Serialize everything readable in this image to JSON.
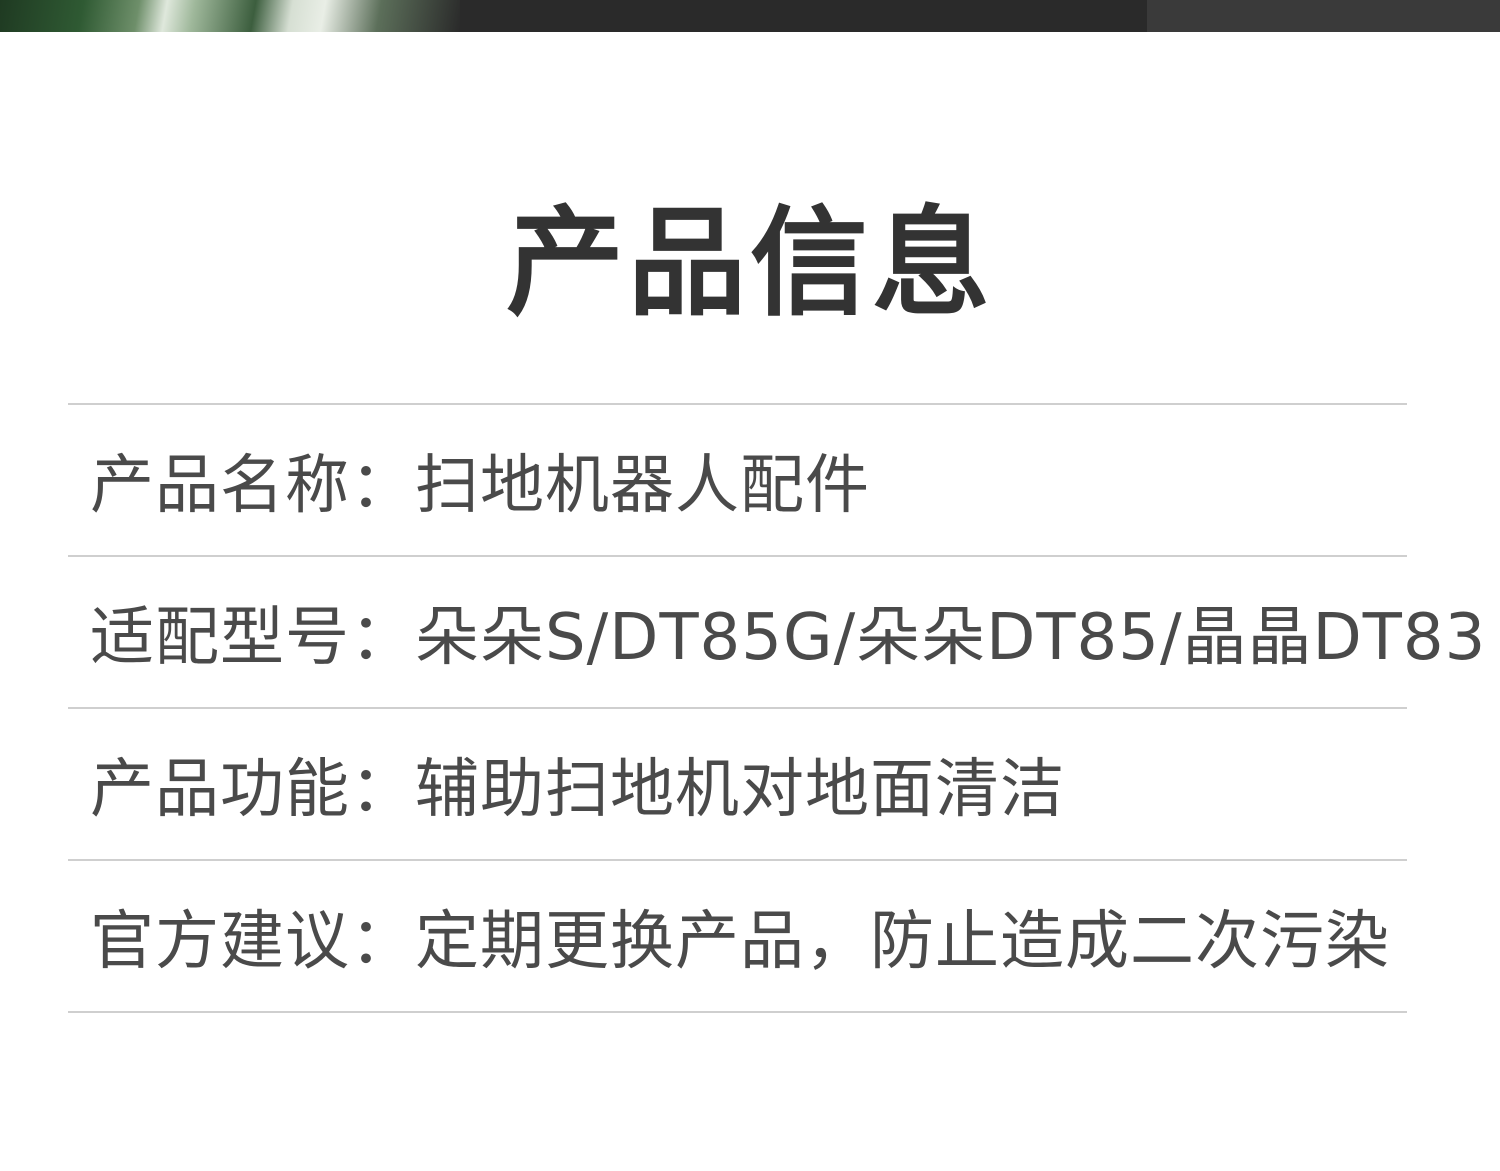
{
  "header": {
    "title": "产品信息"
  },
  "product_info": {
    "rows": [
      {
        "label": "产品名称：",
        "value": "扫地机器人配件"
      },
      {
        "label": "适配型号：",
        "value": "朵朵S/DT85G/朵朵DT85/晶晶DT83"
      },
      {
        "label": "产品功能：",
        "value": "辅助扫地机对地面清洁"
      },
      {
        "label": "官方建议：",
        "value": "定期更换产品，防止造成二次污染"
      }
    ]
  },
  "colors": {
    "title": "#333333",
    "text": "#4a4a4a",
    "divider": "#cfcfcf",
    "banner": "#2a2a2a"
  }
}
